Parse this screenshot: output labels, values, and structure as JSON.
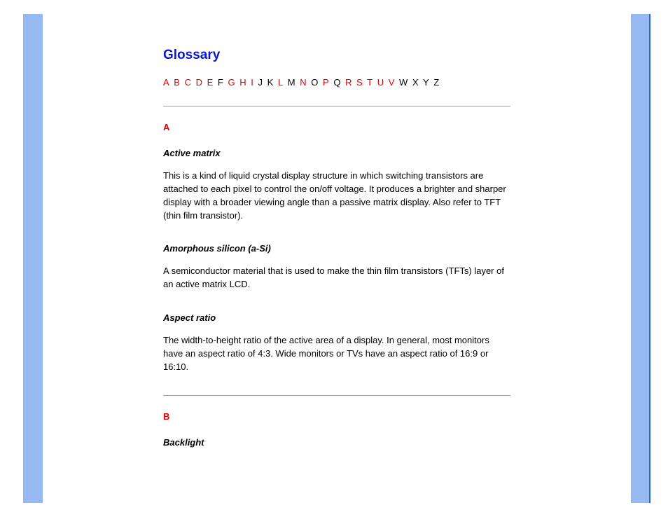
{
  "title": "Glossary",
  "alphaNav": [
    {
      "txt": "A",
      "link": true
    },
    {
      "txt": "B",
      "link": true
    },
    {
      "txt": "C",
      "link": true
    },
    {
      "txt": "D",
      "link": true
    },
    {
      "txt": "E",
      "link": true
    },
    {
      "txt": "F",
      "link": false
    },
    {
      "txt": "G",
      "link": true
    },
    {
      "txt": "H",
      "link": true
    },
    {
      "txt": "I",
      "link": true
    },
    {
      "txt": "J",
      "link": false
    },
    {
      "txt": "K",
      "link": false
    },
    {
      "txt": "L",
      "link": true
    },
    {
      "txt": "M",
      "link": false
    },
    {
      "txt": "N",
      "link": true
    },
    {
      "txt": "O",
      "link": false
    },
    {
      "txt": "P",
      "link": true
    },
    {
      "txt": "Q",
      "link": false
    },
    {
      "txt": "R",
      "link": true
    },
    {
      "txt": "S",
      "link": true
    },
    {
      "txt": "T",
      "link": true
    },
    {
      "txt": "U",
      "link": true
    },
    {
      "txt": "V",
      "link": true
    },
    {
      "txt": "W",
      "link": false
    },
    {
      "txt": "X",
      "link": false
    },
    {
      "txt": "Y",
      "link": false
    },
    {
      "txt": "Z",
      "link": false
    }
  ],
  "sections": [
    {
      "letter": "A",
      "entries": [
        {
          "term": "Active matrix",
          "def": "This is a kind of liquid crystal display structure in which switching transistors are attached to each pixel to control the on/off voltage. It produces a brighter and sharper display with a broader viewing angle than a passive matrix display. Also refer to TFT (thin film transistor)."
        },
        {
          "term": "Amorphous silicon (a-Si)",
          "def": "A semiconductor material that is used to make the thin film transistors (TFTs) layer of an active matrix LCD."
        },
        {
          "term": "Aspect ratio",
          "def": "The width-to-height ratio of the active area of a display. In general, most monitors have an aspect ratio of 4:3. Wide monitors or TVs have an aspect ratio of 16:9 or 16:10."
        }
      ]
    },
    {
      "letter": "B",
      "entries": [
        {
          "term": "Backlight",
          "def": ""
        }
      ]
    }
  ]
}
